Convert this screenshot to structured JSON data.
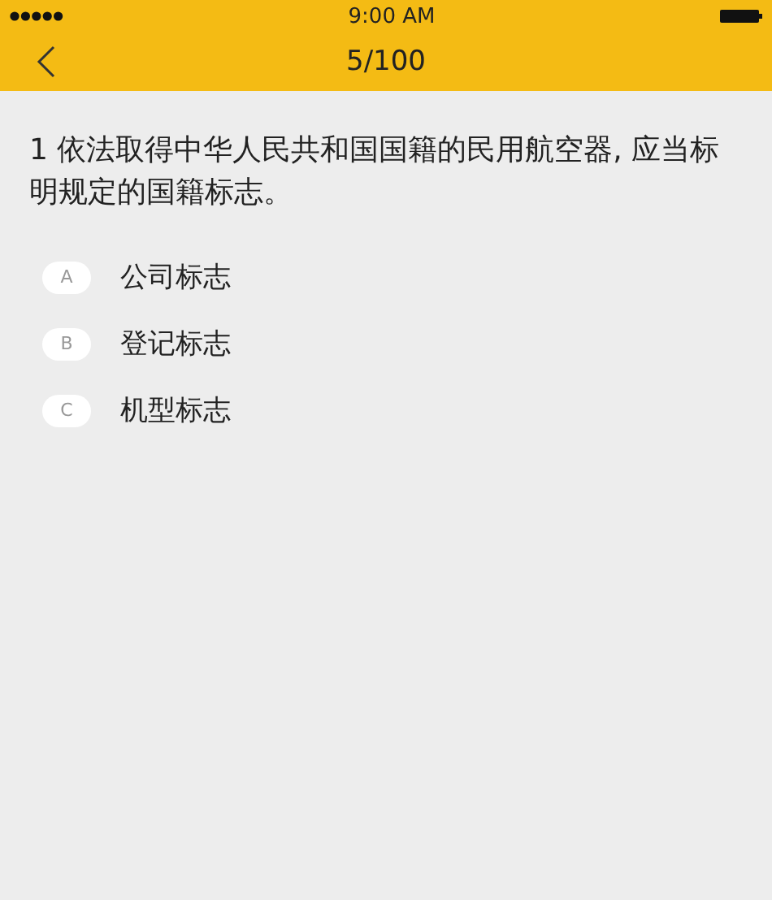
{
  "status_bar": {
    "time": "9:00 AM"
  },
  "nav_bar": {
    "title": "5/100"
  },
  "question": {
    "text": "1 依法取得中华人民共和国国籍的民用航空器, 应当标明规定的国籍标志。"
  },
  "options": [
    {
      "letter": "A",
      "text": "公司标志"
    },
    {
      "letter": "B",
      "text": "登记标志"
    },
    {
      "letter": "C",
      "text": "机型标志"
    }
  ]
}
